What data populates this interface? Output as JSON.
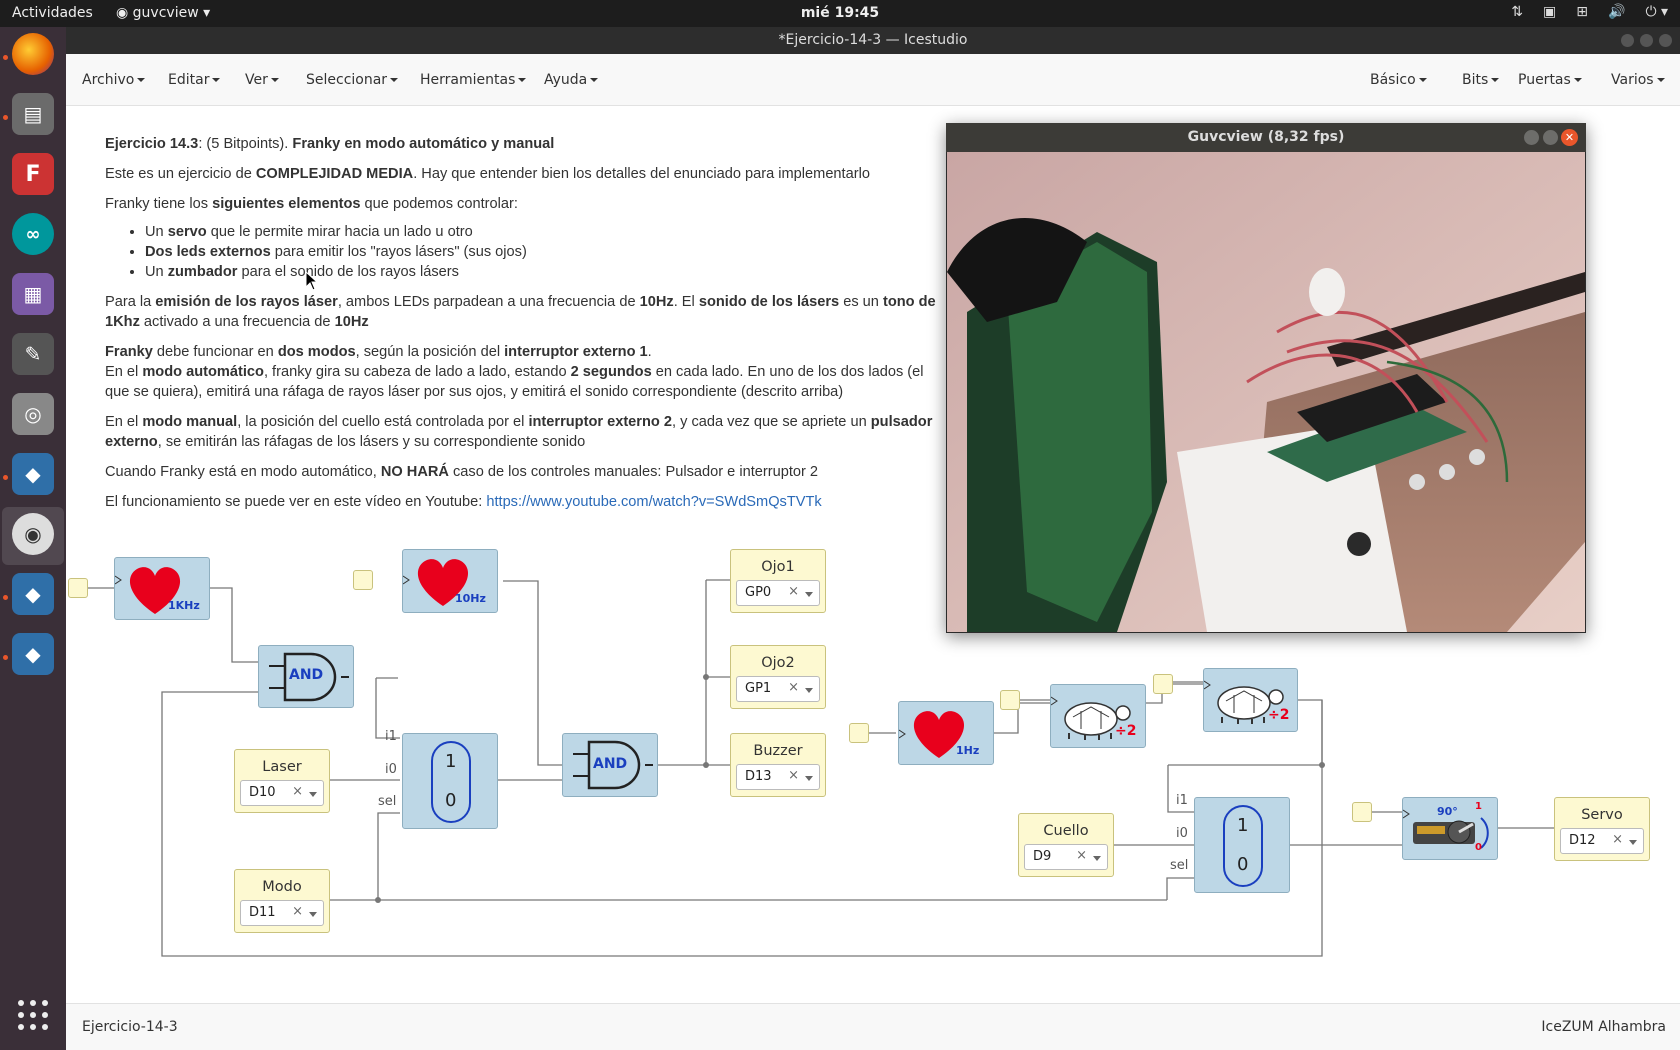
{
  "topbar": {
    "activities": "Actividades",
    "app_menu": "guvcview",
    "clock": "mié 19:45"
  },
  "window": {
    "title": "*Ejercicio-14-3 — Icestudio"
  },
  "menubar": {
    "left": [
      "Archivo",
      "Editar",
      "Ver",
      "Seleccionar",
      "Herramientas",
      "Ayuda"
    ],
    "right": [
      "Básico",
      "Bits",
      "Puertas",
      "Varios"
    ]
  },
  "info": {
    "p1_a": "Ejercicio 14.3",
    "p1_b": ": (5 Bitpoints). ",
    "p1_c": "Franky en modo automático y manual",
    "p2_a": "Este es un ejercicio de ",
    "p2_b": "COMPLEJIDAD MEDIA",
    "p2_c": ". Hay que entender bien los detalles del enunciado para implementarlo",
    "p3_a": "Franky tiene los ",
    "p3_b": "siguientes elementos",
    "p3_c": " que podemos controlar:",
    "li1_a": "Un ",
    "li1_b": "servo",
    "li1_c": " que le permite mirar hacia un lado u otro",
    "li2_a": "Dos leds externos",
    "li2_b": " para emitir los \"rayos lásers\" (sus ojos)",
    "li3_a": "Un ",
    "li3_b": "zumbador",
    "li3_c": " para el sonido de los rayos lásers",
    "p4_a": "Para la ",
    "p4_b": "emisión de los rayos láser",
    "p4_c": ", ambos LEDs parpadean a una frecuencia de ",
    "p4_d": "10Hz",
    "p4_e": ". El ",
    "p4_f": "sonido de los lásers",
    "p4_g": " es un ",
    "p4_h": "tono de 1Khz",
    "p4_i": " activado a una frecuencia de ",
    "p4_j": "10Hz",
    "p5_a": "Franky",
    "p5_b": " debe funcionar en ",
    "p5_c": "dos modos",
    "p5_d": ", según la posición del ",
    "p5_e": "interruptor externo 1",
    "p5_f": ".",
    "p5_g": "En el ",
    "p5_h": "modo automático",
    "p5_i": ", franky gira su cabeza de lado a lado, estando ",
    "p5_j": "2 segundos",
    "p5_k": " en cada lado. En uno de los dos lados (el que se quiera), emitirá una ráfaga de rayos láser por sus ojos, y emitirá el sonido correspondiente (descrito arriba)",
    "p6_a": "En el ",
    "p6_b": "modo manual",
    "p6_c": ", la posición del cuello está controlada por el ",
    "p6_d": "interruptor externo 2",
    "p6_e": ", y cada vez que se apriete un ",
    "p6_f": "pulsador externo",
    "p6_g": ", se emitirán las ráfagas de los lásers y su correspondiente sonido",
    "p7_a": "Cuando Franky está en modo automático, ",
    "p7_b": "NO HARÁ",
    "p7_c": " caso de los controles manuales: Pulsador e interruptor 2",
    "p8_a": "El funcionamiento se puede ver en este vídeo en Youtube: ",
    "p8_link": "https://www.youtube.com/watch?v=SWdSmQsTVTk"
  },
  "circuit": {
    "heart_1khz": "1KHz",
    "heart_10hz": "10Hz",
    "heart_1hz": "1Hz",
    "and_label": "AND",
    "div_label": "÷2",
    "mux": {
      "in1": "i1",
      "in0": "i0",
      "sel": "sel",
      "top": "1",
      "bottom": "0"
    },
    "servo_block": {
      "angle": "90°",
      "mark_1": "1",
      "mark_0": "0"
    },
    "outputs": [
      {
        "name": "Ojo1",
        "pin": "GP0"
      },
      {
        "name": "Ojo2",
        "pin": "GP1"
      },
      {
        "name": "Buzzer",
        "pin": "D13"
      },
      {
        "name": "Servo",
        "pin": "D12"
      }
    ],
    "inputs": [
      {
        "name": "Laser",
        "pin": "D10"
      },
      {
        "name": "Modo",
        "pin": "D11"
      },
      {
        "name": "Cuello",
        "pin": "D9"
      }
    ],
    "remove_symbol": "×"
  },
  "guvcview": {
    "title": "Guvcview  (8,32 fps)"
  },
  "statusbar": {
    "left": "Ejercicio-14-3",
    "right": "IceZUM Alhambra"
  }
}
